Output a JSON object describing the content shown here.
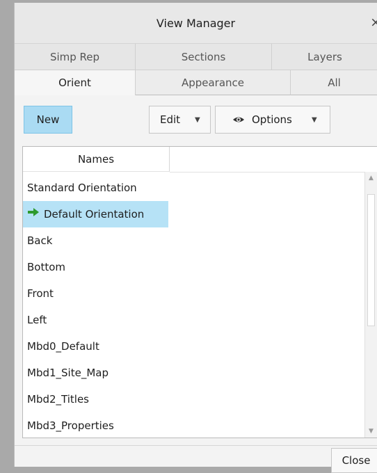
{
  "window": {
    "title": "View Manager",
    "close_glyph": "×"
  },
  "tabs_row1": [
    "Simp Rep",
    "Sections",
    "Layers"
  ],
  "tabs_row2": [
    "Orient",
    "Appearance",
    "All"
  ],
  "toolbar": {
    "new_label": "New",
    "edit_label": "Edit",
    "options_label": "Options",
    "caret": "▼"
  },
  "list": {
    "column_header": "Names",
    "items": [
      "Standard Orientation",
      "Default Orientation",
      "Back",
      "Bottom",
      "Front",
      "Left",
      "Mbd0_Default",
      "Mbd1_Site_Map",
      "Mbd2_Titles",
      "Mbd3_Properties"
    ],
    "selected_item": "Default Orientation"
  },
  "footer": {
    "close_label": "Close"
  },
  "colors": {
    "selection": "#b6e2f6",
    "new_button": "#aadbf3",
    "arrow": "#2e9a2e"
  }
}
